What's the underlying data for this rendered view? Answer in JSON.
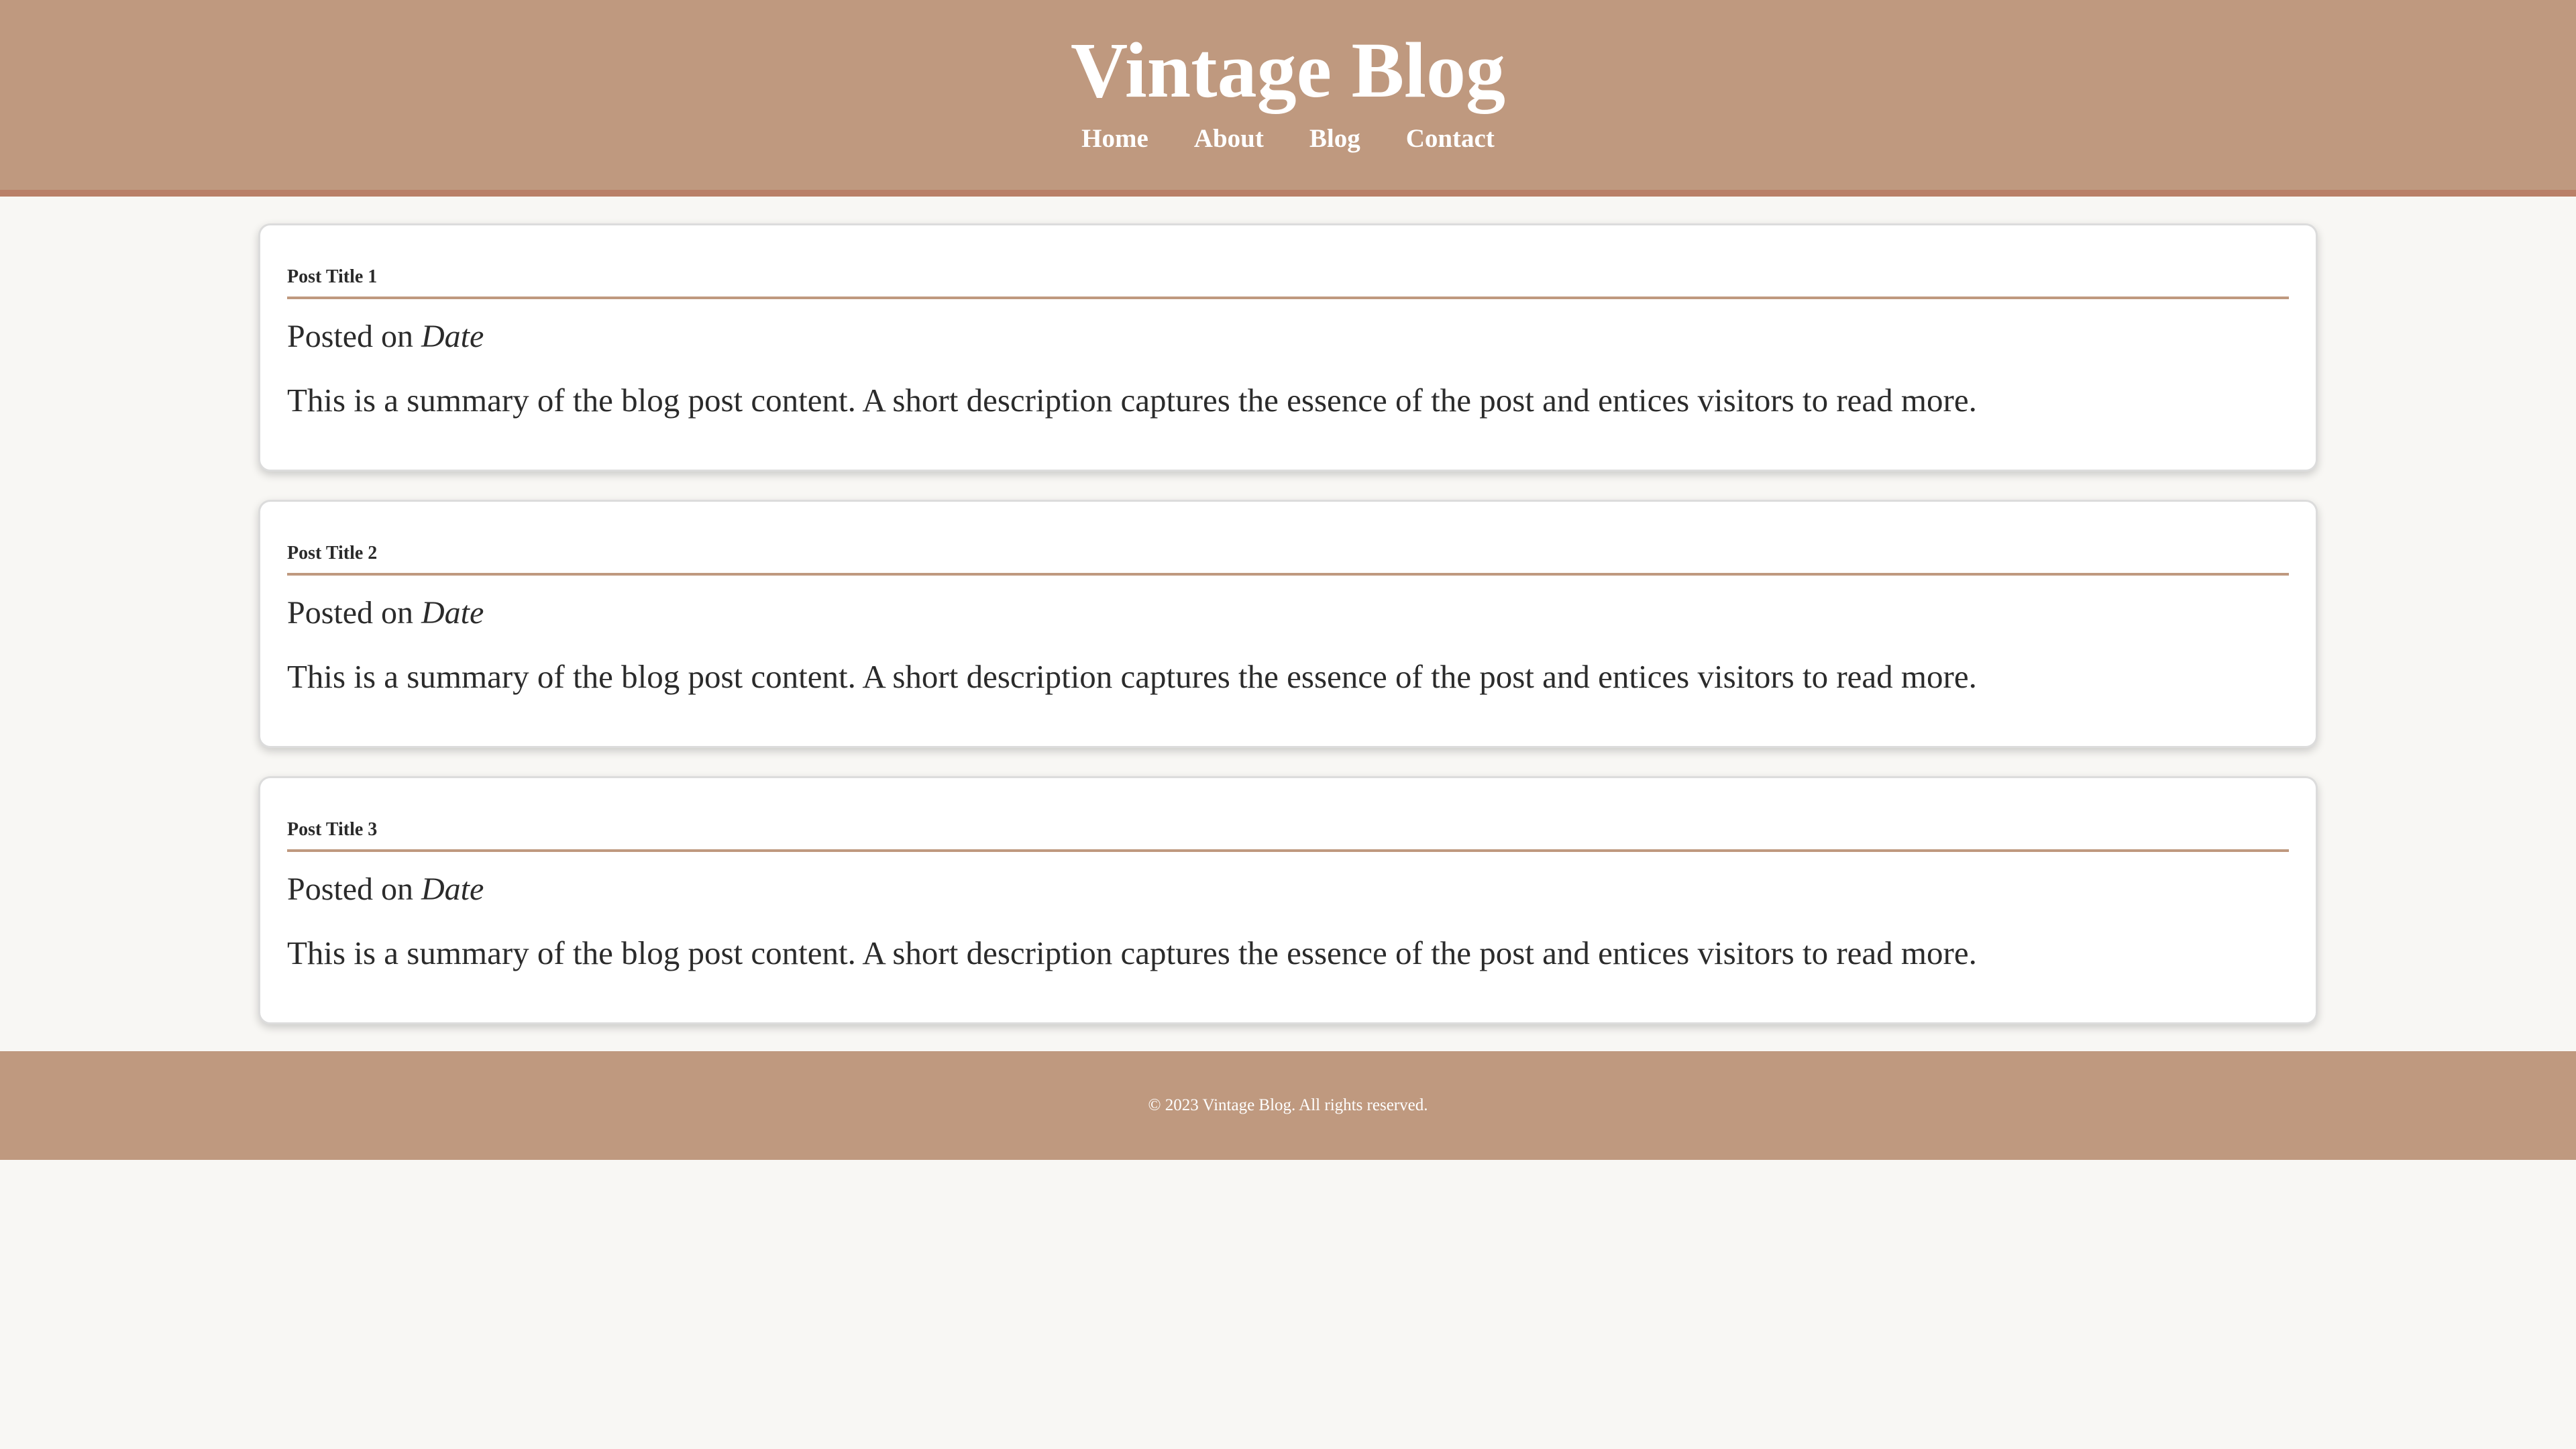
{
  "header": {
    "title": "Vintage Blog",
    "nav": [
      {
        "label": "Home"
      },
      {
        "label": "About"
      },
      {
        "label": "Blog"
      },
      {
        "label": "Contact"
      }
    ]
  },
  "posts": [
    {
      "title": "Post Title 1",
      "posted_prefix": "Posted on",
      "date": "Date",
      "summary": "This is a summary of the blog post content. A short description captures the essence of the post and entices visitors to read more."
    },
    {
      "title": "Post Title 2",
      "posted_prefix": "Posted on",
      "date": "Date",
      "summary": "This is a summary of the blog post content. A short description captures the essence of the post and entices visitors to read more."
    },
    {
      "title": "Post Title 3",
      "posted_prefix": "Posted on",
      "date": "Date",
      "summary": "This is a summary of the blog post content. A short description captures the essence of the post and entices visitors to read more."
    }
  ],
  "footer": {
    "copyright": "© 2023 Vintage Blog. All rights reserved."
  },
  "colors": {
    "header_bg": "#bf997f",
    "accent_line": "#b98068",
    "page_bg": "#f8f7f4",
    "card_bg": "#ffffff"
  }
}
